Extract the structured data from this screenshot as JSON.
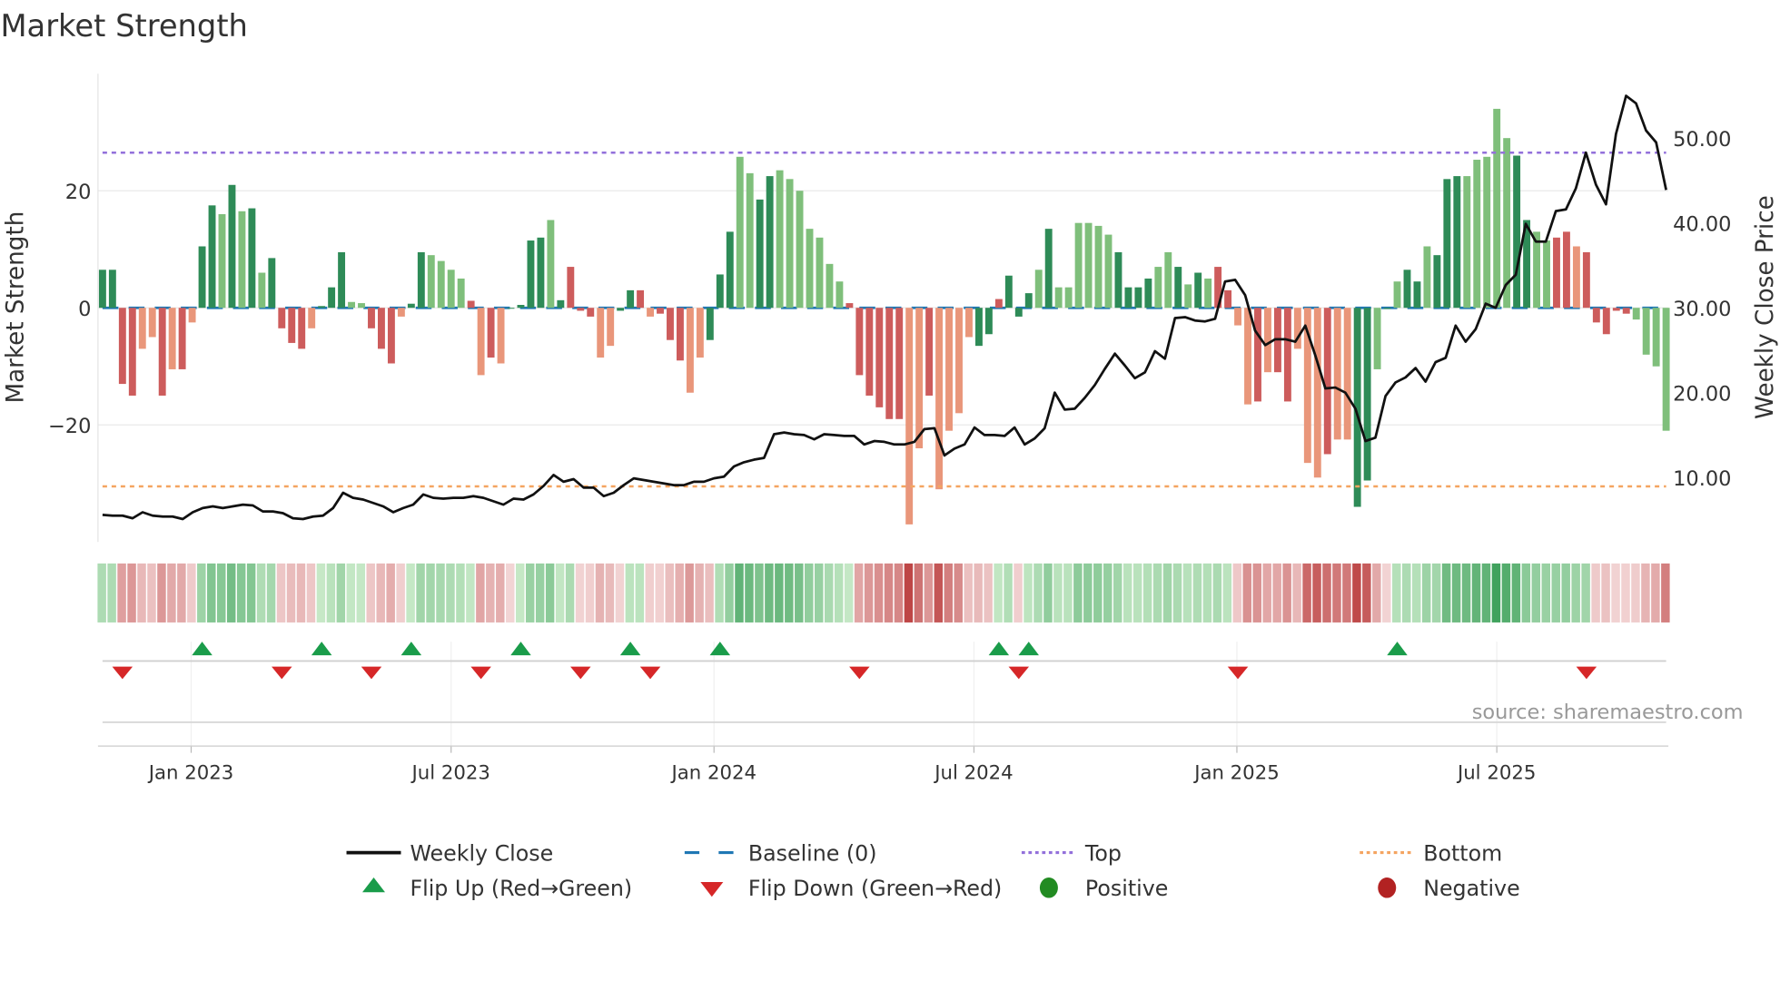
{
  "title": "Market Strength",
  "source": "source: sharemaestro.com",
  "chart_data": {
    "type": "bar",
    "title": "Market Strength",
    "ylabel": "Market Strength",
    "y2label": "Weekly Close Price",
    "ylim": [
      -40,
      40
    ],
    "y2lim": [
      2.4,
      57.6
    ],
    "yticks": [
      {
        "v": 20,
        "label": "20"
      },
      {
        "v": 0,
        "label": "0"
      },
      {
        "v": -20,
        "label": "−20"
      }
    ],
    "y2ticks": [
      {
        "v": 50,
        "label": "50.00"
      },
      {
        "v": 40,
        "label": "40.00"
      },
      {
        "v": 30,
        "label": "30.00"
      },
      {
        "v": 20,
        "label": "20.00"
      },
      {
        "v": 10,
        "label": "10.00"
      }
    ],
    "xticks": [
      {
        "week": 8.9,
        "label": "Jan 2023"
      },
      {
        "week": 35.0,
        "label": "Jul 2023"
      },
      {
        "week": 61.4,
        "label": "Jan 2024"
      },
      {
        "week": 87.5,
        "label": "Jul 2024"
      },
      {
        "week": 113.9,
        "label": "Jan 2025"
      },
      {
        "week": 140.0,
        "label": "Jul 2025"
      }
    ],
    "top_level": 26.5,
    "bottom_level": -30.5,
    "colors": {
      "strong_up": "#2e8b57",
      "weak_up": "#7fbf7b",
      "strong_down": "#cd5c5c",
      "weak_down": "#e9967a",
      "close": "#111111",
      "baseline": "#1f77b4",
      "top": "#9370db",
      "bottom": "#f4a460",
      "flip_up": "#1a9c4a",
      "flip_down": "#d62728",
      "positive": "#228b22",
      "negative": "#b22222"
    },
    "strength": [
      6.5,
      6.5,
      -13,
      -15,
      -7,
      -5,
      -15,
      -10.5,
      -10.5,
      -2.5,
      10.5,
      17.5,
      16,
      21,
      16.5,
      17,
      6,
      8.5,
      -3.5,
      -6,
      -7,
      -3.5,
      0.3,
      3.5,
      9.5,
      1,
      0.8,
      -3.5,
      -7,
      -9.5,
      -1.5,
      0.7,
      9.5,
      9,
      8,
      6.5,
      5,
      1.2,
      -11.5,
      -8.5,
      -9.5,
      -0.1,
      0.5,
      11.5,
      12,
      15,
      1.3,
      7,
      -0.5,
      -1.5,
      -8.5,
      -6.5,
      -0.5,
      3,
      3,
      -1.5,
      -1,
      -5.5,
      -9,
      -14.5,
      -8.5,
      -5.5,
      5.7,
      13,
      25.8,
      23,
      18.5,
      22.5,
      23.5,
      22,
      20,
      13.5,
      12,
      7.5,
      4.5,
      0.8,
      -11.5,
      -15,
      -17,
      -19,
      -19,
      -37,
      -24,
      -15,
      -31,
      -21,
      -18,
      -5,
      -6.5,
      -4.5,
      1.5,
      5.5,
      -1.5,
      2.5,
      6.5,
      13.5,
      3.5,
      3.5,
      14.5,
      14.5,
      14,
      12.5,
      9.5,
      3.5,
      3.5,
      5,
      7,
      9.5,
      7,
      4,
      6,
      5,
      7,
      3,
      -3,
      -16.5,
      -16,
      -11,
      -11,
      -16,
      -7,
      -26.5,
      -29,
      -25,
      -22.5,
      -22.5,
      -34,
      -29.5,
      -10.5,
      -0.2,
      4.5,
      6.5,
      4.5,
      10.5,
      9,
      22,
      22.5,
      22.5,
      25.3,
      25.8,
      34,
      29,
      26,
      15,
      13,
      11.5,
      12,
      13,
      10.5,
      9.5,
      -2.5,
      -4.5,
      -0.5,
      -1,
      -2,
      -8,
      -10,
      -21
    ],
    "strength_type": "GGRRooRoRoGGgGgGgGRRRoGGGggRRRoGGggggRoRoGGGGgGRRRooGGRoRRRooGGGggGGgggggggRRRRRRooRooooGGRGGGgGggggggGGGGggGgGgRRooRoRRoooRooGGgGgGGgGGGgggggGGggRRoRRRRR",
    "weekly_close": [
      5.6,
      5.5,
      5.5,
      5.2,
      5.9,
      5.5,
      5.4,
      5.4,
      5.1,
      5.9,
      6.4,
      6.6,
      6.4,
      6.6,
      6.8,
      6.7,
      6.0,
      6.0,
      5.8,
      5.2,
      5.1,
      5.4,
      5.5,
      6.4,
      8.2,
      7.6,
      7.4,
      7.0,
      6.6,
      5.9,
      6.4,
      6.8,
      8.0,
      7.6,
      7.5,
      7.6,
      7.6,
      7.8,
      7.6,
      7.2,
      6.8,
      7.5,
      7.4,
      8.0,
      9.0,
      10.3,
      9.5,
      9.8,
      8.8,
      8.8,
      7.8,
      8.2,
      9.1,
      9.9,
      9.7,
      9.5,
      9.3,
      9.1,
      9.1,
      9.5,
      9.5,
      9.9,
      10.1,
      11.3,
      11.8,
      12.1,
      12.3,
      15.1,
      15.3,
      15.1,
      15.0,
      14.5,
      15.1,
      15.0,
      14.9,
      14.9,
      13.9,
      14.3,
      14.2,
      13.9,
      13.9,
      14.2,
      15.7,
      15.8,
      12.6,
      13.4,
      13.9,
      15.9,
      15.0,
      15.0,
      14.9,
      15.9,
      13.9,
      14.6,
      15.8,
      20.0,
      18.0,
      18.1,
      19.4,
      20.9,
      22.8,
      24.6,
      23.2,
      21.7,
      22.4,
      24.9,
      24.0,
      28.8,
      28.9,
      28.5,
      28.4,
      28.7,
      33.1,
      33.3,
      31.5,
      27.3,
      25.6,
      26.3,
      26.3,
      26.0,
      27.9,
      24.4,
      20.5,
      20.6,
      20.0,
      18.1,
      14.3,
      14.7,
      19.6,
      21.2,
      21.8,
      22.9,
      21.3,
      23.6,
      24.1,
      27.9,
      26.0,
      27.5,
      30.5,
      30.0,
      32.7,
      33.9,
      39.9,
      37.8,
      37.8,
      41.4,
      41.6,
      44.1,
      48.3,
      44.5,
      42.2,
      50.5,
      55.0,
      54.1,
      50.9,
      49.5,
      43.9
    ],
    "flip_up_weeks": [
      10,
      22,
      31,
      42,
      53,
      62,
      90,
      93,
      130
    ],
    "flip_down_weeks": [
      2,
      18,
      27,
      38,
      48,
      55,
      76,
      92,
      114,
      149
    ]
  },
  "legend": [
    {
      "label": "Weekly Close",
      "kind": "solid",
      "color": "#111111"
    },
    {
      "label": "Baseline (0)",
      "kind": "dashed",
      "color": "#1f77b4"
    },
    {
      "label": "Top",
      "kind": "dotted",
      "color": "#9370db"
    },
    {
      "label": "Bottom",
      "kind": "dotted",
      "color": "#f4a460"
    },
    {
      "label": "Flip Up (Red→Green)",
      "kind": "tri-up",
      "color": "#1a9c4a"
    },
    {
      "label": "Flip Down (Green→Red)",
      "kind": "tri-down",
      "color": "#d62728"
    },
    {
      "label": "Positive",
      "kind": "dot",
      "color": "#228b22"
    },
    {
      "label": "Negative",
      "kind": "dot",
      "color": "#b22222"
    }
  ]
}
